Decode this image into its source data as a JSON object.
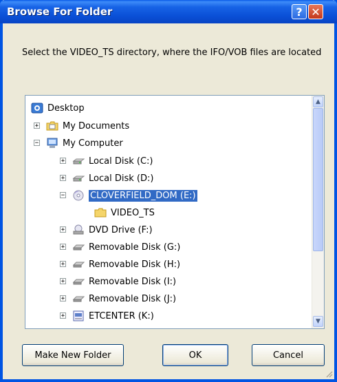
{
  "window": {
    "title": "Browse For Folder",
    "help_glyph": "?",
    "close_glyph": "✕"
  },
  "instruction": "Select the VIDEO_TS directory, where the IFO/VOB files are located",
  "tree": {
    "items": [
      {
        "label": "Desktop",
        "icon": "desktop-icon",
        "expander": ""
      },
      {
        "label": "My Documents",
        "icon": "documents-folder-icon",
        "expander": "+"
      },
      {
        "label": "My Computer",
        "icon": "computer-icon",
        "expander": "−"
      },
      {
        "label": "Local Disk (C:)",
        "icon": "hard-disk-icon",
        "expander": "+"
      },
      {
        "label": "Local Disk (D:)",
        "icon": "hard-disk-icon",
        "expander": "+"
      },
      {
        "label": "CLOVERFIELD_DOM (E:)",
        "icon": "dvd-disc-icon",
        "expander": "−",
        "selected": true
      },
      {
        "label": "VIDEO_TS",
        "icon": "folder-icon",
        "expander": ""
      },
      {
        "label": "DVD Drive (F:)",
        "icon": "dvd-drive-icon",
        "expander": "+"
      },
      {
        "label": "Removable Disk (G:)",
        "icon": "removable-disk-icon",
        "expander": "+"
      },
      {
        "label": "Removable Disk (H:)",
        "icon": "removable-disk-icon",
        "expander": "+"
      },
      {
        "label": "Removable Disk (I:)",
        "icon": "removable-disk-icon",
        "expander": "+"
      },
      {
        "label": "Removable Disk (J:)",
        "icon": "removable-disk-icon",
        "expander": "+"
      },
      {
        "label": "ETCENTER (K:)",
        "icon": "network-drive-icon",
        "expander": "+"
      }
    ]
  },
  "scrollbar": {
    "up": "▲",
    "down": "▼",
    "position": 0.0
  },
  "buttons": {
    "make_new_folder": "Make New Folder",
    "ok": "OK",
    "cancel": "Cancel"
  },
  "colors": {
    "selection": "#316ac5",
    "titlebar": "#0a4fd6",
    "dialog_bg": "#ece9d8"
  }
}
